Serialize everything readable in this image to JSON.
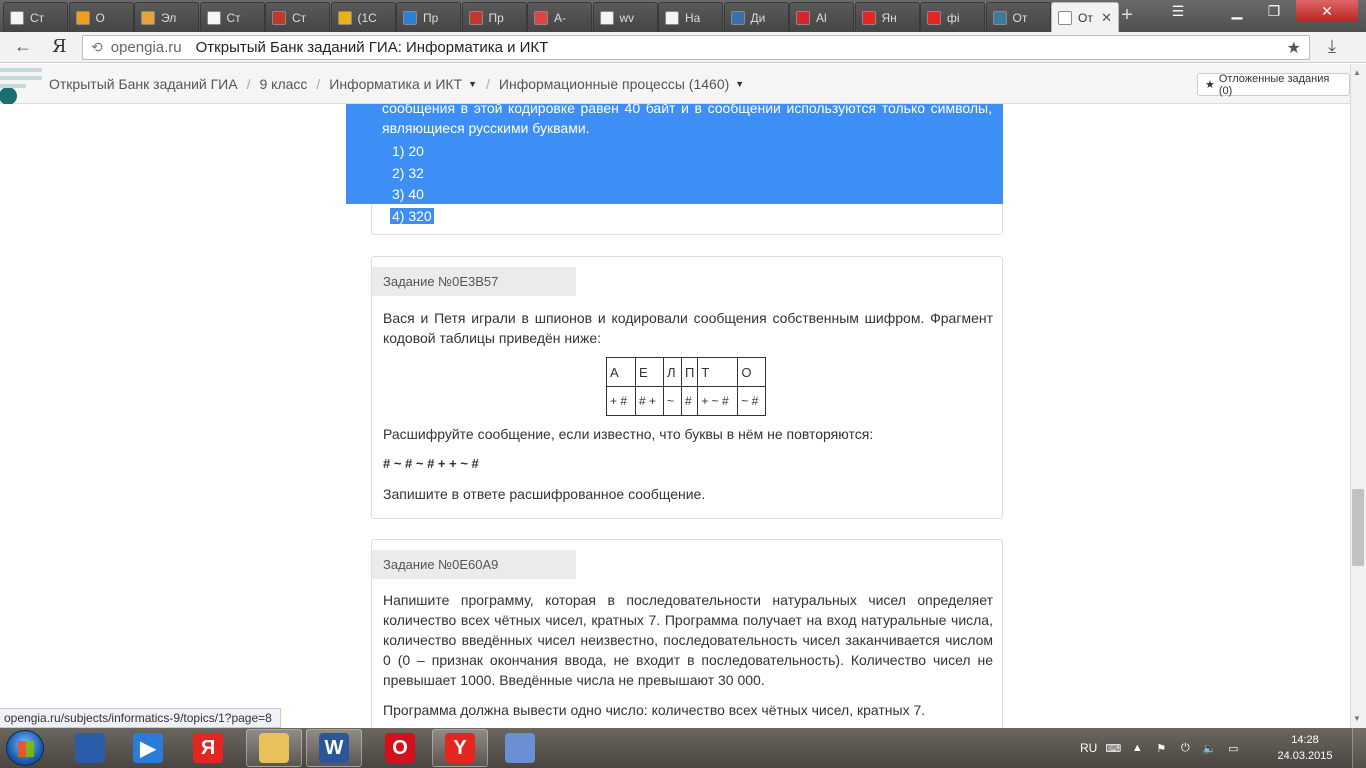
{
  "browser": {
    "tabs": [
      {
        "label": "Ст",
        "icon": "page-icon",
        "color": "#f5f5f5"
      },
      {
        "label": "О",
        "icon": "joomla-icon",
        "color": "#f29b1d"
      },
      {
        "label": "Эл",
        "icon": "sun-icon",
        "color": "#e8a33a"
      },
      {
        "label": "Ст",
        "icon": "page-icon",
        "color": "#f5f5f5"
      },
      {
        "label": "Ст",
        "icon": "books-icon",
        "color": "#c0392b"
      },
      {
        "label": "(1С",
        "icon": "spiral-icon",
        "color": "#e7b416"
      },
      {
        "label": "Пр",
        "icon": "doc-icon",
        "color": "#2f7fd8"
      },
      {
        "label": "Пр",
        "icon": "slides-icon",
        "color": "#c0392b"
      },
      {
        "label": "А-",
        "icon": "atom-icon",
        "color": "#d44"
      },
      {
        "label": "wv",
        "icon": "page-icon",
        "color": "#f5f5f5"
      },
      {
        "label": "На",
        "icon": "page-icon",
        "color": "#f5f5f5"
      },
      {
        "label": "Ди",
        "icon": "chat-icon",
        "color": "#3a6fb0"
      },
      {
        "label": "Al",
        "icon": "aliexpress-icon",
        "color": "#d7262b"
      },
      {
        "label": "Ян",
        "icon": "yandex-icon",
        "color": "#e52620"
      },
      {
        "label": "фі",
        "icon": "yandex-icon",
        "color": "#e52620"
      },
      {
        "label": "От",
        "icon": "puzzle-icon",
        "color": "#3e7a9a"
      },
      {
        "label": "От",
        "icon": "page-icon",
        "color": "#ffffff",
        "active": true
      }
    ],
    "new_tab": "+",
    "yandex_button": "Я",
    "domain": "opengia.ru",
    "page_title": "Открытый Банк заданий ГИА: Информатика и ИКТ"
  },
  "site": {
    "breadcrumb": {
      "home": "Открытый Банк заданий ГИА",
      "grade": "9 класс",
      "subject": "Информатика и ИКТ",
      "topic": "Информационные процессы (1460)"
    },
    "deferred_button": "Отложенные задания (0)"
  },
  "tasks": {
    "first": {
      "tail_text": "сообщения в этой кодировке равен 40 байт и в сообщении используются только символы, являющиеся русскими буквами.",
      "answers": [
        "1) 20",
        "2) 32",
        "3) 40",
        "4) 320"
      ]
    },
    "second": {
      "header": "Задание №0E3B57",
      "intro": "Вася и Петя играли в шпионов и кодировали сообщения собственным шифром. Фрагмент кодовой таблицы приведён ниже:",
      "table_letters": [
        "А",
        "Е",
        "Л",
        "П",
        "Т",
        "О"
      ],
      "table_codes": [
        "+ #",
        "# +",
        "~",
        "#",
        "+ ~ #",
        "~ #"
      ],
      "question": "Расшифруйте сообщение, если известно, что буквы в нём не повторяются:",
      "message": "# ~ # ~ # + + ~ #",
      "instruction": "Запишите в ответе расшифрованное сообщение."
    },
    "third": {
      "header": "Задание №0E60A9",
      "text": "Напишите программу, которая в последовательности натуральных чисел определяет количество всех чётных чисел, кратных 7. Программа получает на вход натуральные числа, количество введённых чисел неизвестно, последовательность чисел заканчивается числом 0 (0 – признак окончания ввода, не входит в последовательность). Количество чисел не превышает 1000. Введённые числа не превышают 30 000.",
      "output_text": "Программа должна вывести одно число: количество всех чётных чисел, кратных 7."
    }
  },
  "status_url": "opengia.ru/subjects/informatics-9/topics/1?page=8",
  "taskbar": {
    "apps": [
      {
        "name": "blender-app-icon",
        "label": "",
        "color": "#2a5caa",
        "running": false
      },
      {
        "name": "media-player-app-icon",
        "label": "▶",
        "color": "#2b7bd8",
        "running": false
      },
      {
        "name": "yandex-browser-app-icon",
        "label": "Я",
        "color": "#e52620",
        "running": false
      },
      {
        "name": "file-explorer-app-icon",
        "label": "",
        "color": "#e8c15a",
        "running": true
      },
      {
        "name": "word-app-icon",
        "label": "W",
        "color": "#2b579a",
        "running": true
      },
      {
        "name": "opera-app-icon",
        "label": "O",
        "color": "#d1111c",
        "running": false
      },
      {
        "name": "yandex-app-icon",
        "label": "Y",
        "color": "#e52620",
        "running": true
      },
      {
        "name": "paint-app-icon",
        "label": "",
        "color": "#6b8fd4",
        "running": false
      }
    ],
    "language": "RU",
    "time": "14:28",
    "date": "24.03.2015"
  }
}
